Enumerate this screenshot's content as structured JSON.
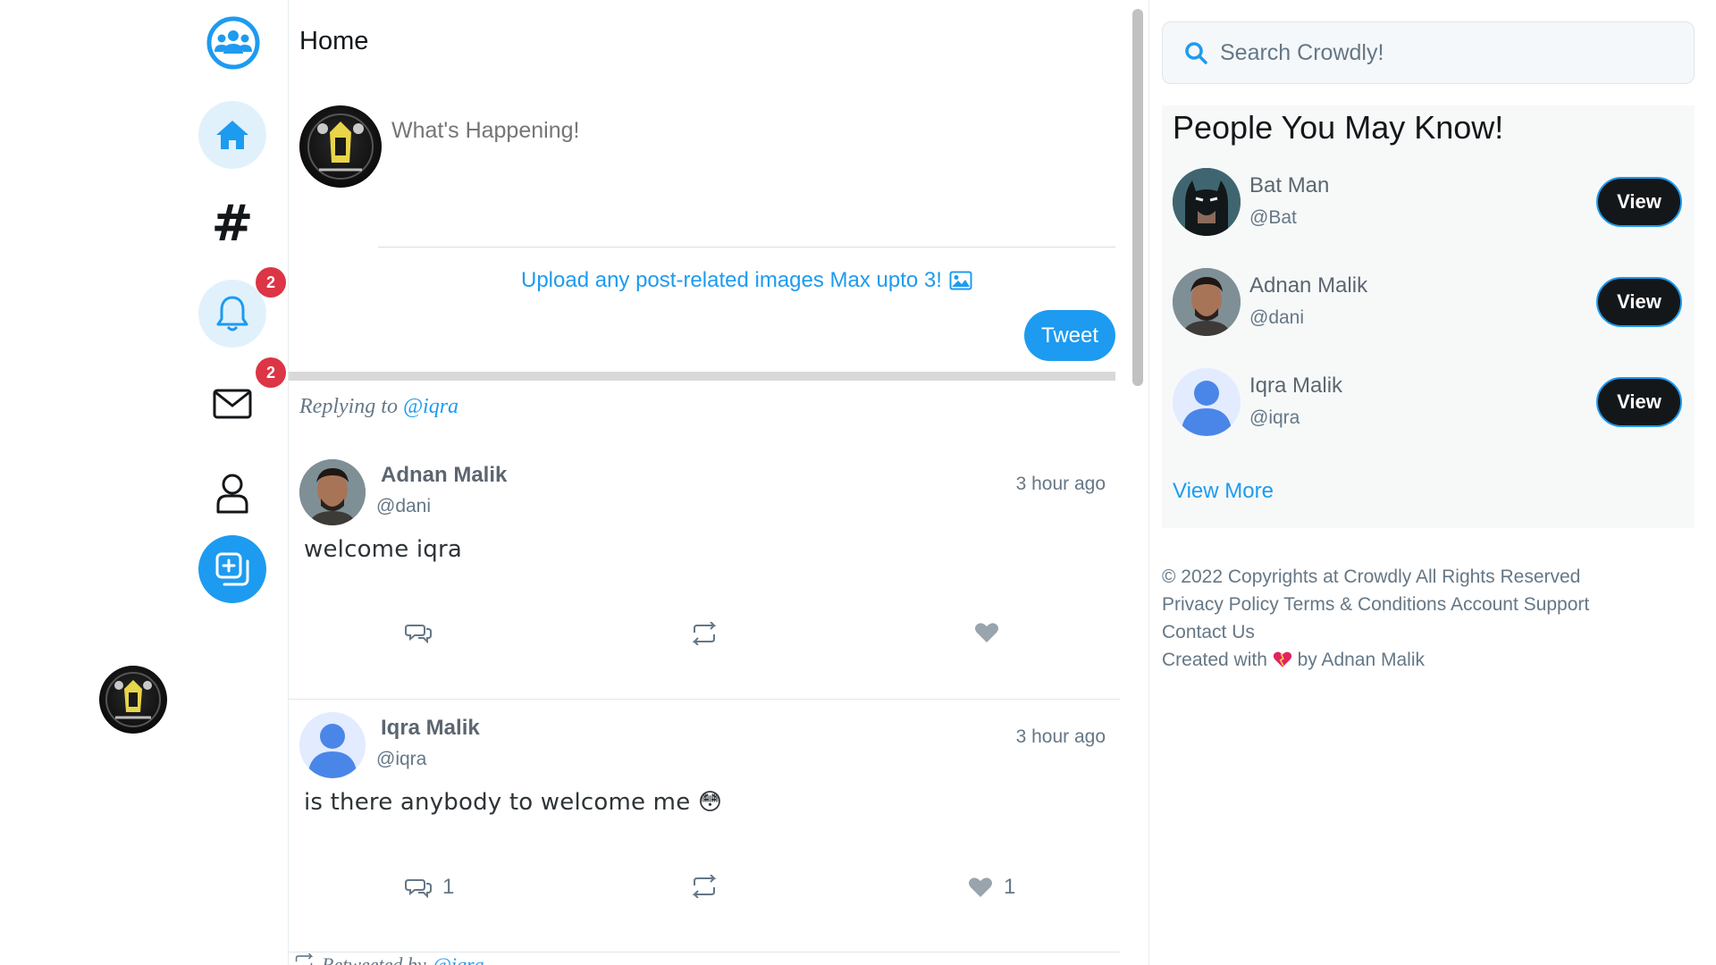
{
  "nav": {
    "notifications_badge": "2",
    "messages_badge": "2"
  },
  "feed": {
    "title": "Home",
    "compose_placeholder": "What's Happening!",
    "upload_label": "Upload any post-related images Max upto 3!",
    "tweet_label": "Tweet",
    "replying_prefix": "Replying to",
    "replying_mention": "@iqra",
    "retweeted_prefix": "Retweeted by",
    "retweeted_mention": "@iqra",
    "posts": [
      {
        "name": "Adnan Malik",
        "handle": "@dani",
        "time": "3 hour ago",
        "text": "welcome iqra",
        "comments": "",
        "likes": ""
      },
      {
        "name": "Iqra Malik",
        "handle": "@iqra",
        "time": "3 hour ago",
        "text": "is there anybody to welcome me 😳",
        "comments": "1",
        "likes": "1"
      }
    ]
  },
  "sidebar": {
    "search_placeholder": "Search Crowdly!",
    "pymk_title": "People You May Know!",
    "people": [
      {
        "name": "Bat Man",
        "handle": "@Bat",
        "button": "View"
      },
      {
        "name": "Adnan Malik",
        "handle": "@dani",
        "button": "View"
      },
      {
        "name": "Iqra Malik",
        "handle": "@iqra",
        "button": "View"
      }
    ],
    "view_more": "View More"
  },
  "footer": {
    "copyright": "© 2022 Copyrights at Crowdly All Rights Reserved",
    "privacy": "Privacy Policy",
    "terms": "Terms & Conditions",
    "account": "Account",
    "support": "Support",
    "contact": "Contact Us",
    "created_prefix": "Created with",
    "created_suffix": "by Adnan Malik"
  },
  "colors": {
    "accent": "#1d9bf0",
    "badge": "#dc3545",
    "dark_button": "#14171a"
  }
}
